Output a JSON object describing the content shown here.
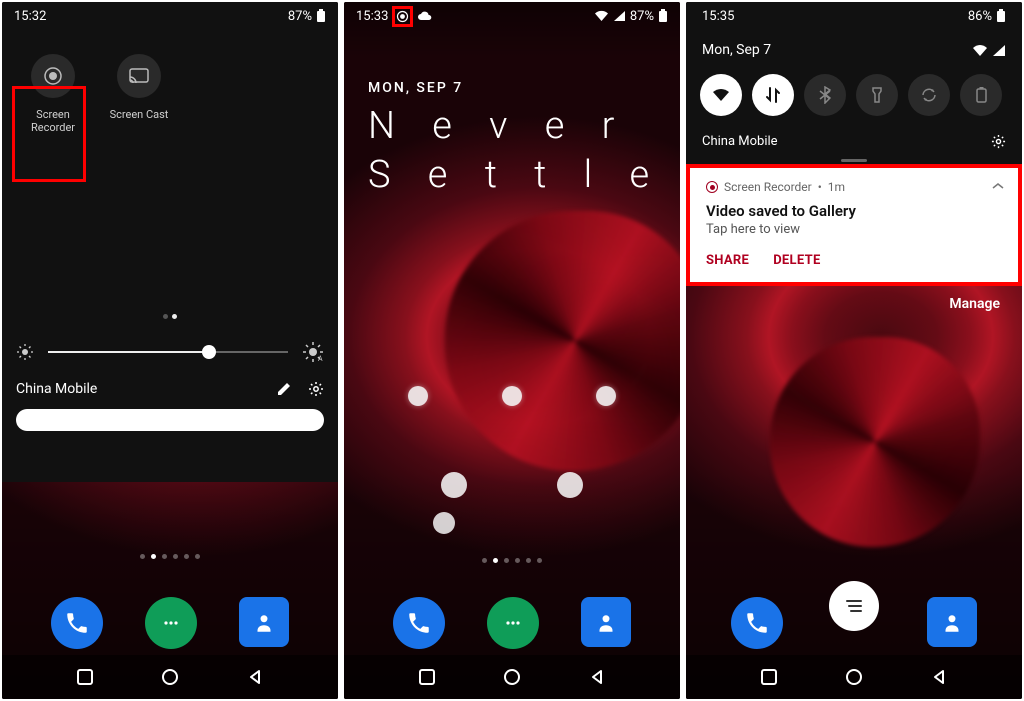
{
  "phone1": {
    "status": {
      "time": "15:32",
      "battery": "87%"
    },
    "tiles": [
      {
        "label": "Screen\nRecorder"
      },
      {
        "label": "Screen Cast"
      }
    ],
    "carrier": "China Mobile"
  },
  "phone2": {
    "status": {
      "time": "15:33",
      "battery": "87%"
    },
    "date": "MON, SEP 7",
    "motto_l1": "N e v e r",
    "motto_l2": "S e t t l e"
  },
  "phone3": {
    "status": {
      "time": "15:35",
      "battery": "86%"
    },
    "date": "Mon, Sep 7",
    "carrier": "China Mobile",
    "notif": {
      "app": "Screen Recorder",
      "time_sep": "  •  ",
      "time": "1m",
      "title": "Video saved to Gallery",
      "body": "Tap here to view",
      "action_share": "SHARE",
      "action_delete": "DELETE"
    },
    "manage": "Manage"
  }
}
